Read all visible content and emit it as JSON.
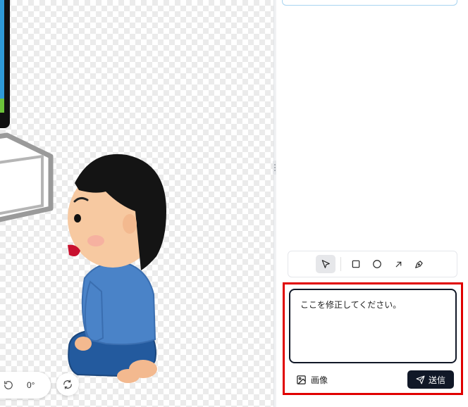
{
  "canvas": {
    "rotation_label": "0°"
  },
  "annotation_tools": [
    {
      "name": "select-tool",
      "icon": "cursor-arrow-icon",
      "active": true
    },
    {
      "name": "rectangle-tool",
      "icon": "square-icon",
      "active": false
    },
    {
      "name": "ellipse-tool",
      "icon": "circle-icon",
      "active": false
    },
    {
      "name": "arrow-tool",
      "icon": "arrow-up-right-icon",
      "active": false
    },
    {
      "name": "pen-tool",
      "icon": "pen-nib-icon",
      "active": false
    }
  ],
  "composer": {
    "text": "ここを修正してください。",
    "image_label": "画像",
    "send_label": "送信"
  },
  "colors": {
    "highlight": "#e00000",
    "primary": "#111827"
  }
}
